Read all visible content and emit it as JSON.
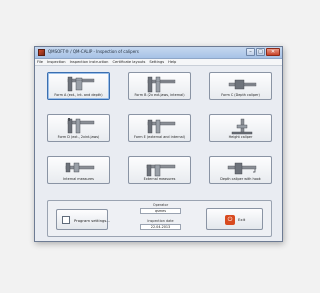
{
  "window": {
    "title": "QMSOFT® / QM-CALIP - Inspection of calipers",
    "controls": {
      "minimize": "–",
      "maximize": "□",
      "close": "✕"
    }
  },
  "menu": [
    "File",
    "Inspection",
    "Inspection instruction",
    "Certificate layouts",
    "Settings",
    "Help"
  ],
  "tiles": [
    {
      "label": "Form A (ext., int. and depth)",
      "icon": "caliper-form-a-icon"
    },
    {
      "label": "Form B (2x ext.jaws, internal)",
      "icon": "caliper-form-b-icon"
    },
    {
      "label": "Form C (Depth caliper)",
      "icon": "caliper-form-c-icon"
    },
    {
      "label": "Form D (ext., 2xint.jaws)",
      "icon": "caliper-form-d-icon"
    },
    {
      "label": "Form E (external and internal)",
      "icon": "caliper-form-e-icon"
    },
    {
      "label": "Height caliper",
      "icon": "height-caliper-icon"
    },
    {
      "label": "Internal measures",
      "icon": "internal-caliper-icon"
    },
    {
      "label": "External measures",
      "icon": "external-caliper-icon"
    },
    {
      "label": "Depth caliper with hook",
      "icon": "depth-hook-caliper-icon"
    }
  ],
  "program_settings": {
    "label": "Program settings..."
  },
  "operator": {
    "label": "Operator",
    "value": "qsmes"
  },
  "inspection_date": {
    "label": "Inspection date",
    "value": "22.04.2013"
  },
  "exit": {
    "label": "Exit",
    "icon_glyph": "⏻"
  }
}
